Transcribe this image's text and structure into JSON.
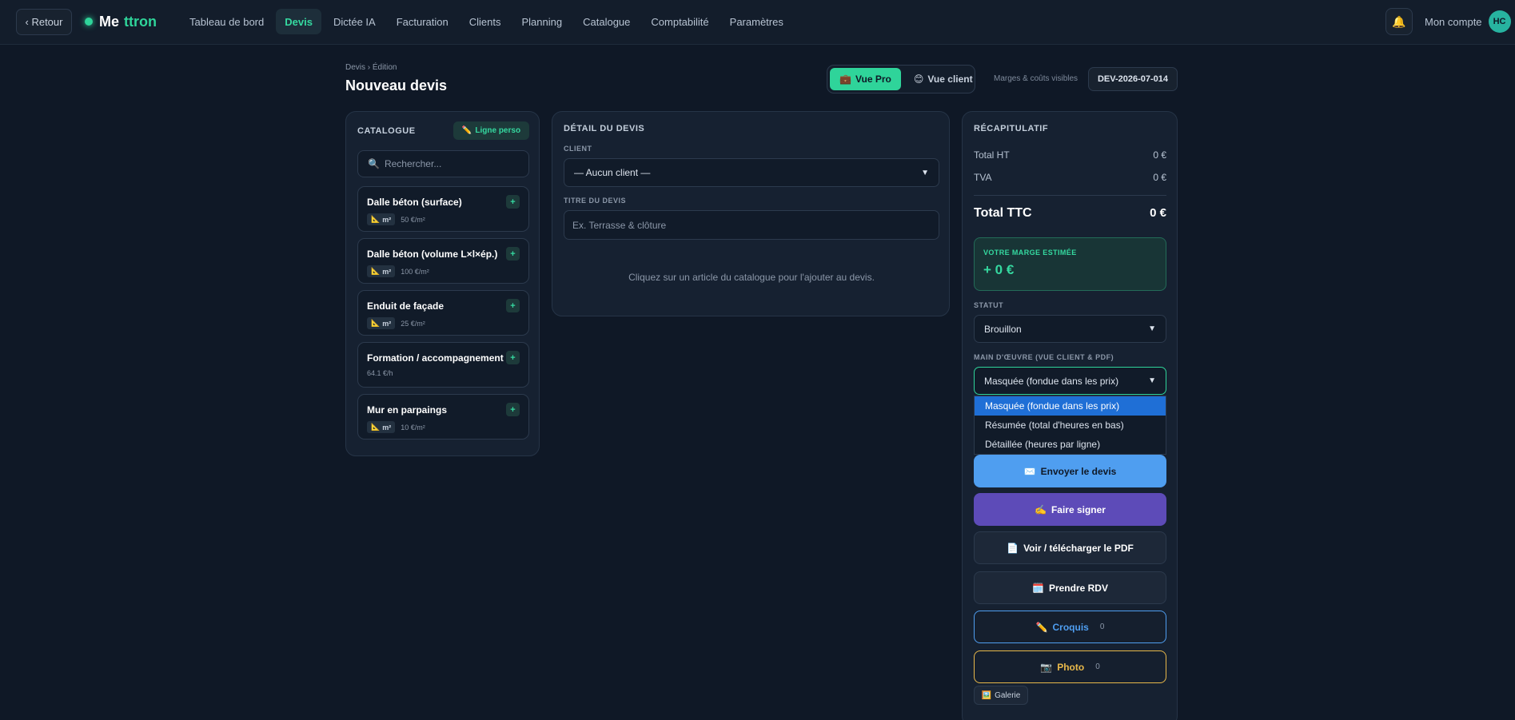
{
  "header": {
    "back_label": "‹ Retour",
    "logo_main": "Me",
    "logo_accent": "ttron",
    "nav": [
      "Tableau de bord",
      "Devis",
      "Dictée IA",
      "Facturation",
      "Clients",
      "Planning",
      "Catalogue",
      "Comptabilité",
      "Paramètres"
    ],
    "active_nav": "Devis",
    "bell_icon": "🔔",
    "account_label": "Mon compte",
    "avatar_initials": "HC"
  },
  "page": {
    "breadcrumb": "Devis › Édition",
    "title": "Nouveau devis",
    "view_pro_icon": "💼",
    "view_pro_label": "Vue Pro",
    "view_client_icon": "😊",
    "view_client_label": "Vue client",
    "margins_note": "Marges & coûts visibles",
    "quote_ref": "DEV-2026-07-014"
  },
  "catalogue": {
    "title": "CATALOGUE",
    "custom_line_icon": "✏️",
    "custom_line_label": "Ligne perso",
    "search_icon": "🔍",
    "search_placeholder": "Rechercher...",
    "add_symbol": "+",
    "items": [
      {
        "name": "Dalle béton (surface)",
        "unit": "m²",
        "unit_icon": "📐",
        "price": "50 €/m²"
      },
      {
        "name": "Dalle béton (volume L×l×ép.)",
        "unit": "m²",
        "unit_icon": "📐",
        "price": "100 €/m²"
      },
      {
        "name": "Enduit de façade",
        "unit": "m²",
        "unit_icon": "📐",
        "price": "25 €/m²"
      },
      {
        "name": "Formation / accompagnement",
        "price": "64.1 €/h"
      },
      {
        "name": "Mur en parpaings",
        "unit": "m²",
        "unit_icon": "📐",
        "price": "10 €/m²"
      }
    ]
  },
  "detail": {
    "title": "DÉTAIL DU DEVIS",
    "client_label": "CLIENT",
    "client_value": "— Aucun client —",
    "quote_title_label": "TITRE DU DEVIS",
    "quote_title_placeholder": "Ex. Terrasse & clôture",
    "empty_hint": "Cliquez sur un article du catalogue pour l'ajouter au devis."
  },
  "recap": {
    "title": "RÉCAPITULATIF",
    "total_ht_label": "Total HT",
    "total_ht_value": "0 €",
    "tva_label": "TVA",
    "tva_value": "0 €",
    "total_ttc_label": "Total TTC",
    "total_ttc_value": "0 €",
    "margin_label": "VOTRE MARGE ESTIMÉE",
    "margin_value": "+ 0 €",
    "status_label": "STATUT",
    "status_value": "Brouillon",
    "labor_label": "MAIN D'ŒUVRE (VUE CLIENT & PDF)",
    "labor_value": "Masquée (fondue dans les prix)",
    "labor_options": [
      "Masquée (fondue dans les prix)",
      "Résumée (total d'heures en bas)",
      "Détaillée (heures par ligne)"
    ],
    "send": {
      "icon": "✉️",
      "label": "Envoyer le devis"
    },
    "sign": {
      "icon": "✍️",
      "label": "Faire signer"
    },
    "pdf": {
      "icon": "📄",
      "label": "Voir / télécharger le PDF"
    },
    "rdv": {
      "icon": "🗓️",
      "label": "Prendre RDV"
    },
    "croquis": {
      "icon": "✏️",
      "label": "Croquis",
      "count": "0"
    },
    "photo": {
      "icon": "📷",
      "label": "Photo",
      "count": "0"
    },
    "gallery": {
      "icon": "🖼️",
      "label": "Galerie"
    }
  },
  "colors": {
    "background": "#0f1826",
    "panel": "#162131",
    "accent": "#2fd49a",
    "send_blue": "#4f9ef0",
    "sign_purple": "#5d4bb8",
    "photo_gold": "#e8b84a"
  }
}
